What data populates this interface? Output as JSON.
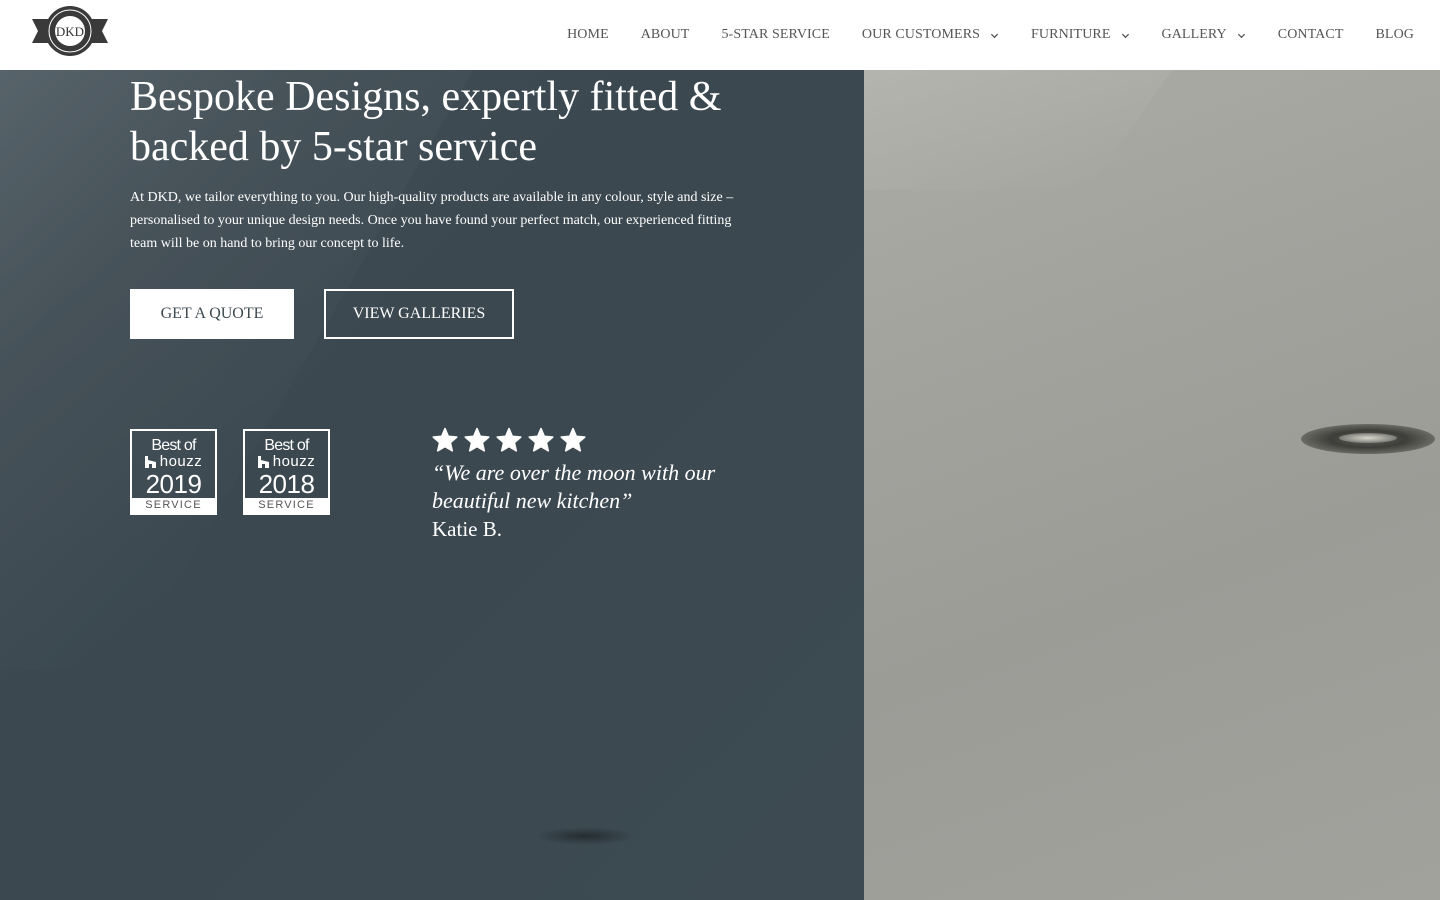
{
  "brand": {
    "logo_text": "DKD",
    "logo_icon": "dkd-logo-icon"
  },
  "nav": {
    "items": [
      {
        "label": "HOME",
        "has_dropdown": false
      },
      {
        "label": "ABOUT",
        "has_dropdown": false
      },
      {
        "label": "5-STAR SERVICE",
        "has_dropdown": false
      },
      {
        "label": "OUR CUSTOMERS",
        "has_dropdown": true
      },
      {
        "label": "FURNITURE",
        "has_dropdown": true
      },
      {
        "label": "GALLERY",
        "has_dropdown": true
      },
      {
        "label": "CONTACT",
        "has_dropdown": false
      },
      {
        "label": "BLOG",
        "has_dropdown": false
      }
    ]
  },
  "hero": {
    "headline": "Bespoke Designs, expertly fitted & backed by 5-star service",
    "intro": "At DKD, we tailor everything to you. Our high-quality products are available in any colour, style and size – personalised to your unique design needs. Once you have found your perfect match, our experienced fitting team will be on hand to bring our concept to life.",
    "buttons": {
      "quote": "GET A QUOTE",
      "galleries": "VIEW GALLERIES"
    }
  },
  "badges": [
    {
      "top": "Best of",
      "brand": "houzz",
      "year": "2019",
      "category": "SERVICE"
    },
    {
      "top": "Best of",
      "brand": "houzz",
      "year": "2018",
      "category": "SERVICE"
    }
  ],
  "testimonial": {
    "rating": 5,
    "rating_max": 5,
    "quote": "“We are over the moon with our beautiful new kitchen”",
    "author": "Katie B."
  },
  "colors": {
    "panel": "#3d4a51",
    "nav_text": "#555555",
    "white": "#ffffff"
  }
}
